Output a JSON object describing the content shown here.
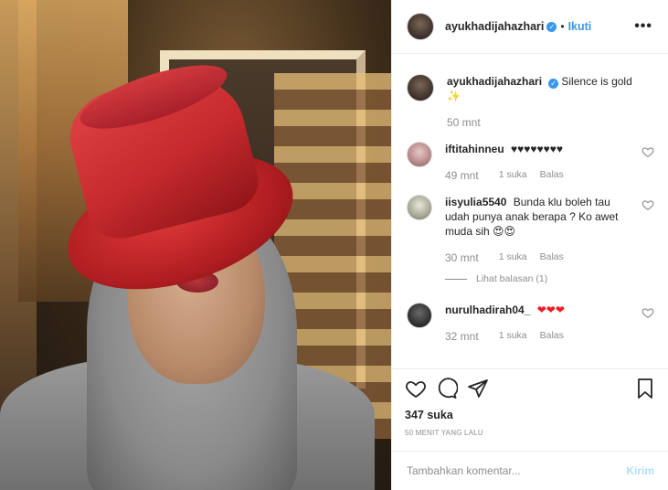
{
  "post": {
    "username": "ayukhadijahazhari",
    "follow_label": "Ikuti",
    "more_label": "•••",
    "caption": "Silence is gold",
    "caption_emoji": "✨",
    "caption_time": "50 mnt"
  },
  "comments": [
    {
      "username": "iftitahinneu",
      "text": "♥♥♥♥♥♥♥♥",
      "time": "49 mnt",
      "likes": "1 suka",
      "reply_label": "Balas"
    },
    {
      "username": "iisyulia5540",
      "text": "Bunda klu boleh tau udah punya anak berapa ? Ko awet muda sih 😍😍",
      "time": "30 mnt",
      "likes": "1 suka",
      "reply_label": "Balas",
      "view_replies": "Lihat balasan (1)"
    },
    {
      "username": "nurulhadirah04_",
      "text": "❤❤❤",
      "time": "32 mnt",
      "likes": "1 suka",
      "reply_label": "Balas"
    }
  ],
  "likes_count": "347 suka",
  "posted_ago": "50 MENIT YANG LALU",
  "add_comment": {
    "placeholder": "Tambahkan komentar...",
    "send_label": "Kirim"
  },
  "colors": {
    "accent": "#3897f0",
    "muted": "#8e8e8e",
    "send_disabled": "#b2dffc",
    "hat": "#c62a2e",
    "heart": "#ed1c24"
  }
}
